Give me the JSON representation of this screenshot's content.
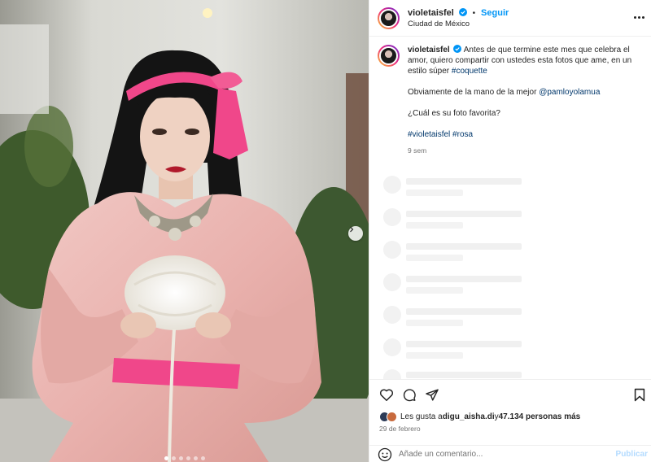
{
  "post_header": {
    "username": "violetaisfel",
    "separator": "•",
    "follow_label": "Seguir",
    "location": "Ciudad de México"
  },
  "caption": {
    "username": "violetaisfel",
    "line1_text": "Antes de que termine este mes que celebra el amor, quiero compartir con ustedes esta fotos que ame, en un estilo súper ",
    "line1_tag": "#coquette",
    "line2_text": "Obviamente de la mano de la mejor ",
    "line2_tag": "@pamloyolamua",
    "line3_text": "¿Cuál es su foto favorita?",
    "hashtag1": "#violetaisfel",
    "hashtag2": "#rosa",
    "time_ago": "9 sem"
  },
  "likes": {
    "prefix": "Les gusta a ",
    "user": "digu_aisha.di",
    "middle": " y ",
    "count": "47.134 personas más"
  },
  "post_date": "29 de febrero",
  "comment_box": {
    "placeholder": "Añade un comentario...",
    "publish_label": "Publicar"
  },
  "carousel": {
    "slides": 6,
    "active_index": 0
  },
  "colors": {
    "accent": "#0095f6",
    "verified": "#0095f6",
    "hashtag": "#00376b",
    "ribbon": "#f0478a"
  },
  "icons": [
    "heart-icon",
    "comment-icon",
    "share-icon",
    "bookmark-icon",
    "emoji-icon",
    "more-options-icon",
    "verified-badge-icon",
    "chevron-right-icon"
  ]
}
